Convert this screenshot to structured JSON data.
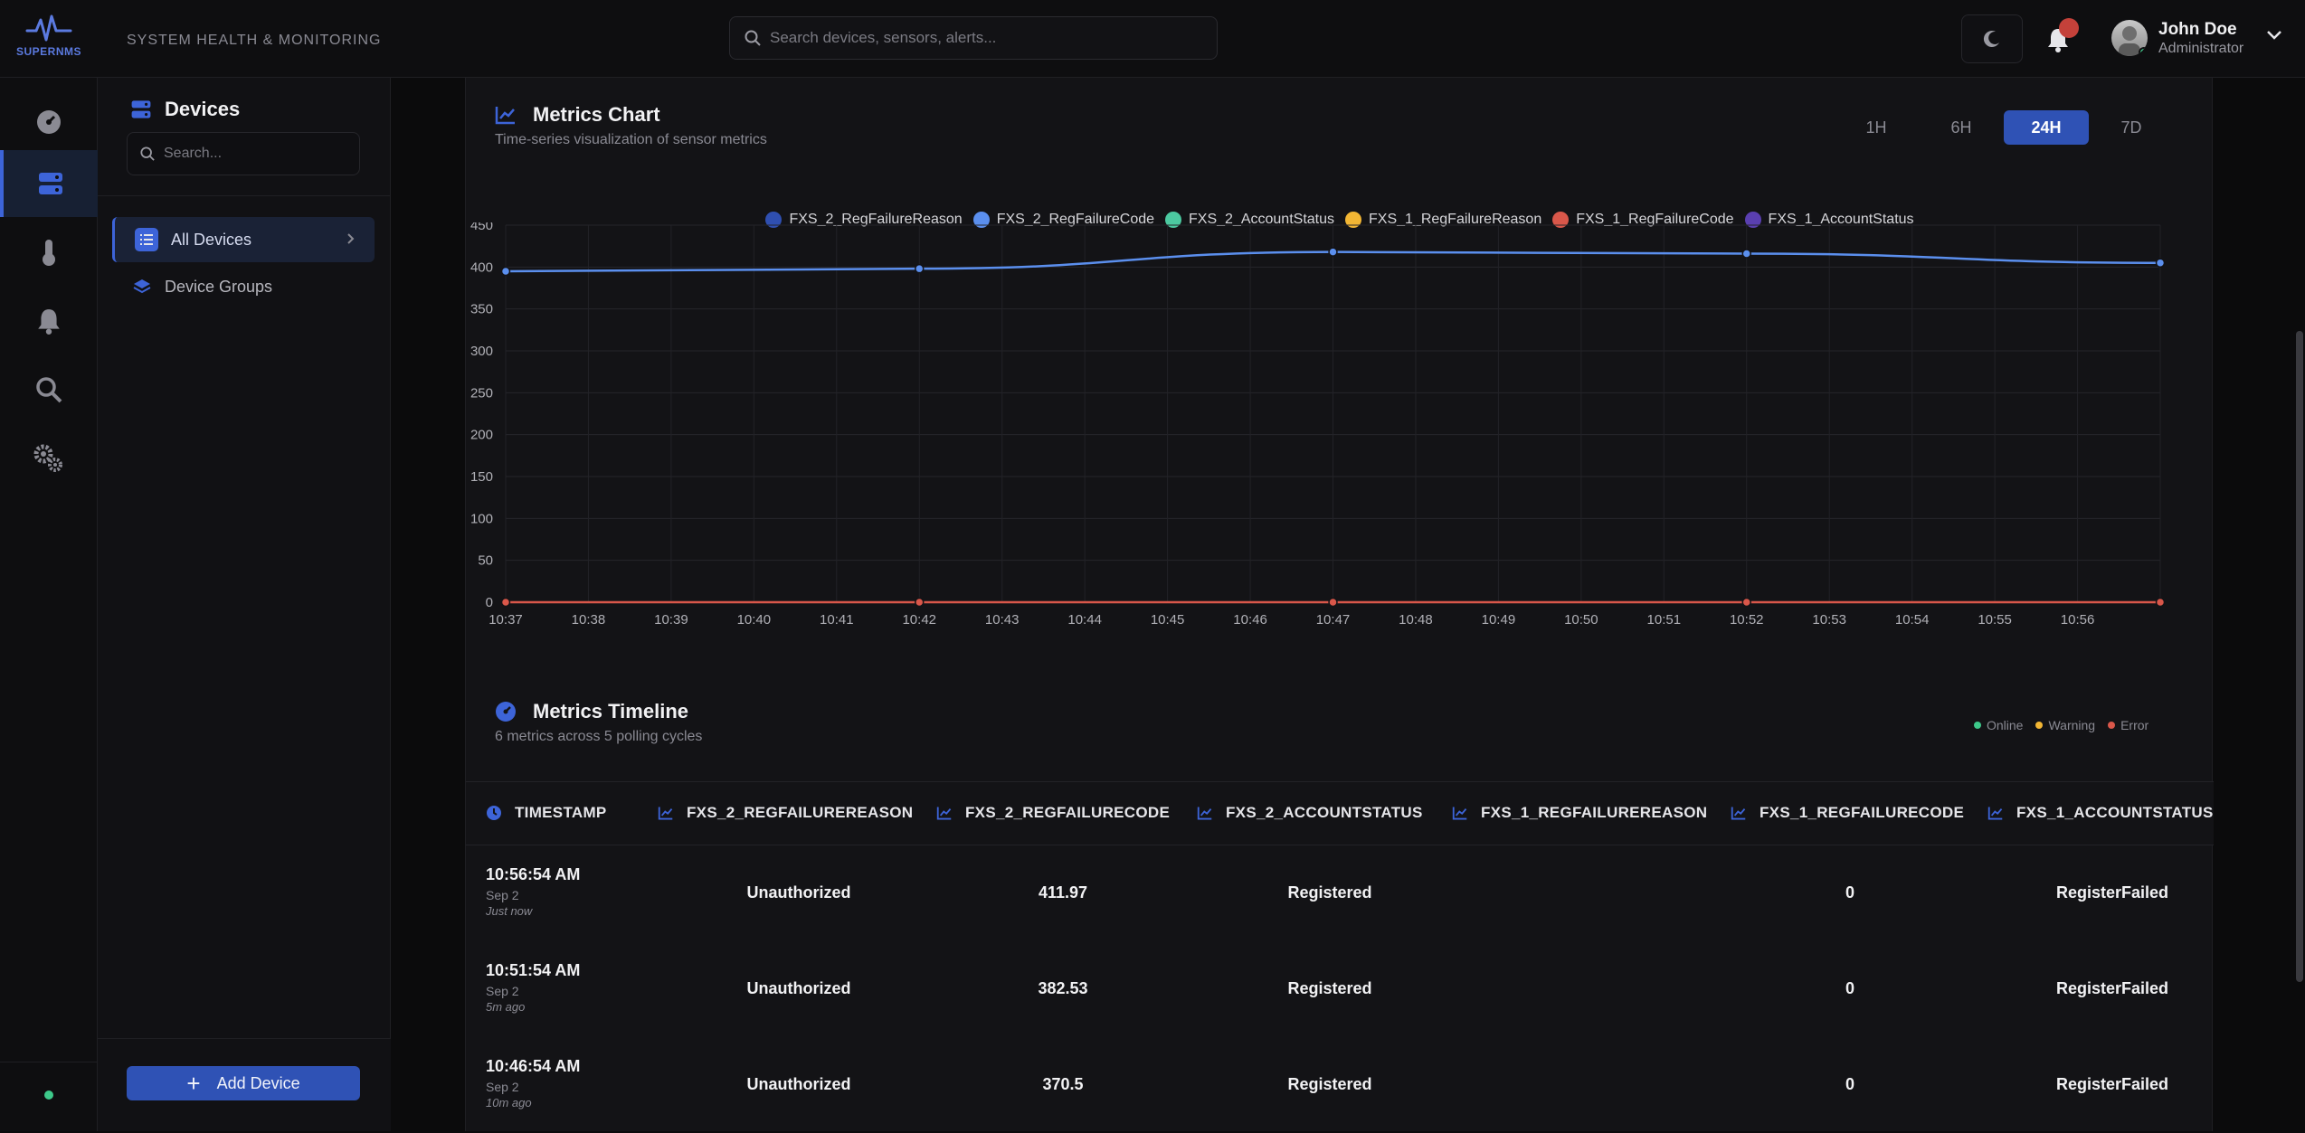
{
  "app": {
    "logo_text": "SUPERNMS",
    "system_title": "SYSTEM HEALTH & MONITORING",
    "search_placeholder": "Search devices, sensors, alerts..."
  },
  "user": {
    "name": "John Doe",
    "role": "Administrator"
  },
  "rail": [
    "dashboard-icon",
    "devices-icon",
    "thermometer-icon",
    "bell-icon",
    "search-icon",
    "settings-icon"
  ],
  "sidebar": {
    "title": "Devices",
    "search_placeholder": "Search...",
    "items": [
      {
        "label": "All Devices",
        "icon": "list-icon",
        "active": true
      },
      {
        "label": "Device Groups",
        "icon": "layers-icon",
        "active": false
      }
    ],
    "add_button": "Add Device"
  },
  "metrics_chart": {
    "title": "Metrics Chart",
    "subtitle": "Time-series visualization of sensor metrics",
    "ranges": [
      "1H",
      "6H",
      "24H",
      "7D"
    ],
    "active_range": "24H"
  },
  "chart_data": {
    "type": "line",
    "x_ticks": [
      "10:37",
      "10:38",
      "10:39",
      "10:40",
      "10:41",
      "10:42",
      "10:43",
      "10:44",
      "10:45",
      "10:46",
      "10:47",
      "10:48",
      "10:49",
      "10:50",
      "10:51",
      "10:52",
      "10:53",
      "10:54",
      "10:55",
      "10:56"
    ],
    "x_range": [
      "10:37",
      "10:57"
    ],
    "ylim": [
      0,
      450
    ],
    "y_ticks": [
      0,
      50,
      100,
      150,
      200,
      250,
      300,
      350,
      400,
      450
    ],
    "grid": true,
    "legend_position": "top",
    "points_x": [
      "10:37",
      "10:42",
      "10:47",
      "10:52",
      "10:57"
    ],
    "series": [
      {
        "name": "FXS_2_RegFailureReason",
        "color": "#2f4fb0",
        "values": null
      },
      {
        "name": "FXS_2_RegFailureCode",
        "color": "#5b8fee",
        "values": [
          395,
          398,
          418,
          416,
          405
        ]
      },
      {
        "name": "FXS_2_AccountStatus",
        "color": "#4cc9a0",
        "values": null
      },
      {
        "name": "FXS_1_RegFailureReason",
        "color": "#f2b634",
        "values": null
      },
      {
        "name": "FXS_1_RegFailureCode",
        "color": "#d9574a",
        "values": [
          0,
          0,
          0,
          0,
          0
        ]
      },
      {
        "name": "FXS_1_AccountStatus",
        "color": "#5a3fb0",
        "values": null
      }
    ]
  },
  "timeline": {
    "title": "Metrics Timeline",
    "subtitle": "6 metrics across 5 polling cycles",
    "status_legend": [
      {
        "label": "Online",
        "color": "#3dc98a"
      },
      {
        "label": "Warning",
        "color": "#f2b634"
      },
      {
        "label": "Error",
        "color": "#d9574a"
      }
    ],
    "columns": [
      "TIMESTAMP",
      "FXS_2_REGFAILUREREASON",
      "FXS_2_REGFAILURECODE",
      "FXS_2_ACCOUNTSTATUS",
      "FXS_1_REGFAILUREREASON",
      "FXS_1_REGFAILURECODE",
      "FXS_1_ACCOUNTSTATUS"
    ],
    "rows": [
      {
        "time": "10:56:54 AM",
        "date": "Sep 2",
        "ago": "Just now",
        "c1": "Unauthorized",
        "c2": "411.97",
        "c3": "Registered",
        "c4": "",
        "c5": "0",
        "c6": "RegisterFailed"
      },
      {
        "time": "10:51:54 AM",
        "date": "Sep 2",
        "ago": "5m ago",
        "c1": "Unauthorized",
        "c2": "382.53",
        "c3": "Registered",
        "c4": "",
        "c5": "0",
        "c6": "RegisterFailed"
      },
      {
        "time": "10:46:54 AM",
        "date": "Sep 2",
        "ago": "10m ago",
        "c1": "Unauthorized",
        "c2": "370.5",
        "c3": "Registered",
        "c4": "",
        "c5": "0",
        "c6": "RegisterFailed"
      }
    ]
  }
}
